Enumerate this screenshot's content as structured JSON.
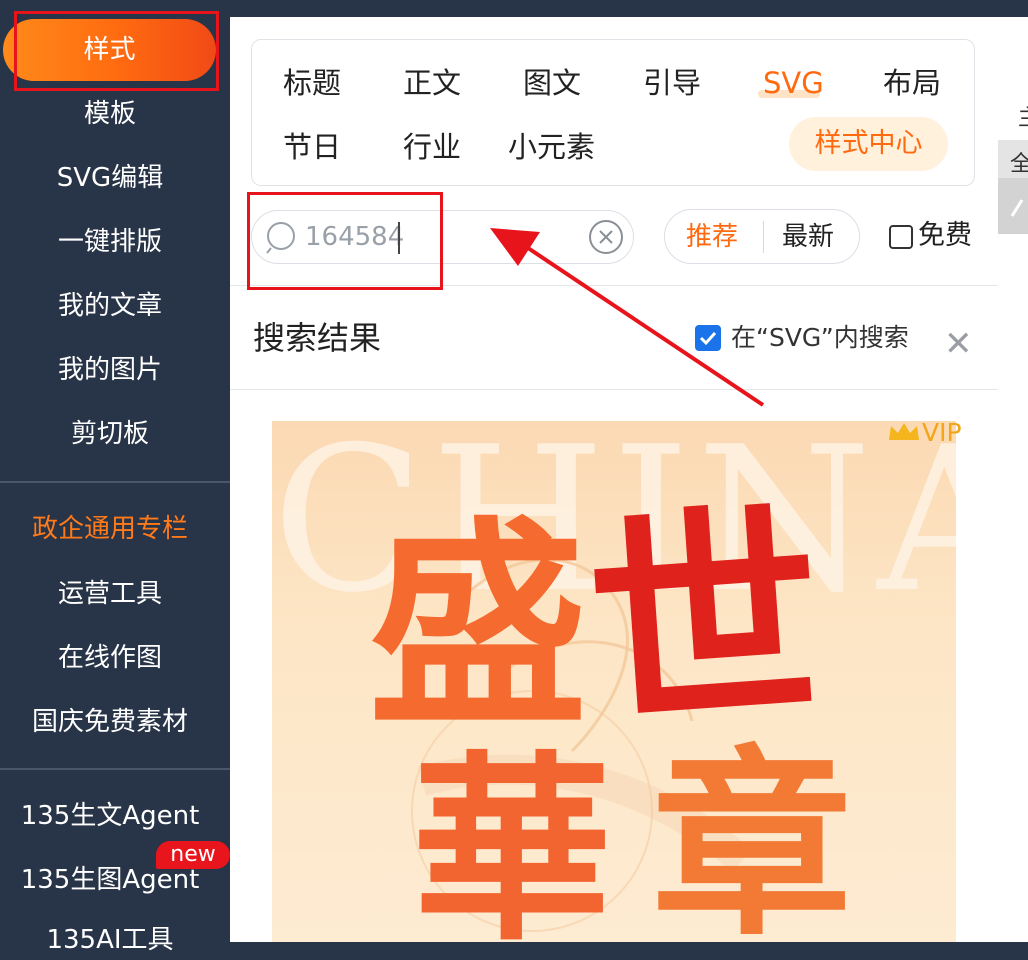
{
  "sidebar": {
    "active": "样式",
    "items": [
      "模板",
      "SVG编辑",
      "一键排版",
      "我的文章",
      "我的图片",
      "剪切板"
    ],
    "section": [
      "政企通用专栏",
      "运营工具",
      "在线作图",
      "国庆免费素材"
    ],
    "agents": [
      "135生文Agent",
      "135生图Agent",
      "135AI工具"
    ],
    "badge": "new"
  },
  "categories": {
    "row1": [
      "标题",
      "正文",
      "图文",
      "引导",
      "SVG",
      "布局"
    ],
    "row2": [
      "节日",
      "行业",
      "小元素"
    ],
    "active": "SVG",
    "style_center": "样式中心"
  },
  "search": {
    "value": "164584",
    "placeholder": ""
  },
  "sort": {
    "recommended": "推荐",
    "latest": "最新"
  },
  "filter": {
    "free_label": "免费",
    "free_checked": false
  },
  "results": {
    "title": "搜索结果",
    "scope_label": "在“SVG”内搜索",
    "scope_checked": true
  },
  "card": {
    "vip_label": "VIP",
    "bg_text": "CHINA",
    "title_chars": [
      "盛",
      "世",
      "華",
      "章"
    ]
  },
  "right_strip": [
    "主",
    "全"
  ],
  "colors": {
    "accent": "#ff6a10",
    "sidebar_bg": "#283447",
    "annotation_red": "#e8141b",
    "checkbox_blue": "#1a73e8"
  }
}
